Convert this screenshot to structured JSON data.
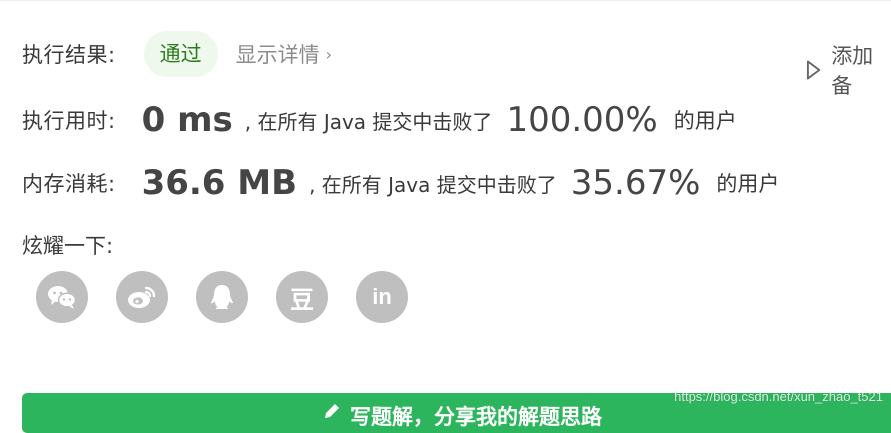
{
  "result": {
    "label": "执行结果:",
    "status": "通过",
    "details_link": "显示详情",
    "add_note": "添加备"
  },
  "runtime": {
    "label": "执行用时:",
    "value": "0 ms",
    "middle": ", 在所有 Java 提交中击败了",
    "percent": "100.00%",
    "tail": "的用户"
  },
  "memory": {
    "label": "内存消耗:",
    "value": "36.6 MB",
    "middle": ", 在所有 Java 提交中击败了",
    "percent": "35.67%",
    "tail": "的用户"
  },
  "share": {
    "label": "炫耀一下:",
    "icons": [
      "wechat-icon",
      "weibo-icon",
      "qq-icon",
      "douban-icon",
      "linkedin-icon"
    ],
    "douban_glyph": "豆",
    "linkedin_glyph": "in"
  },
  "solution_button": {
    "label": "写题解，分享我的解题思路"
  },
  "watermark": "https://blog.csdn.net/xun_zhao_t521",
  "colors": {
    "accent_green": "#2db55d",
    "status_pill_bg": "#eef8ec",
    "share_icon_bg": "#bfbfbf"
  }
}
